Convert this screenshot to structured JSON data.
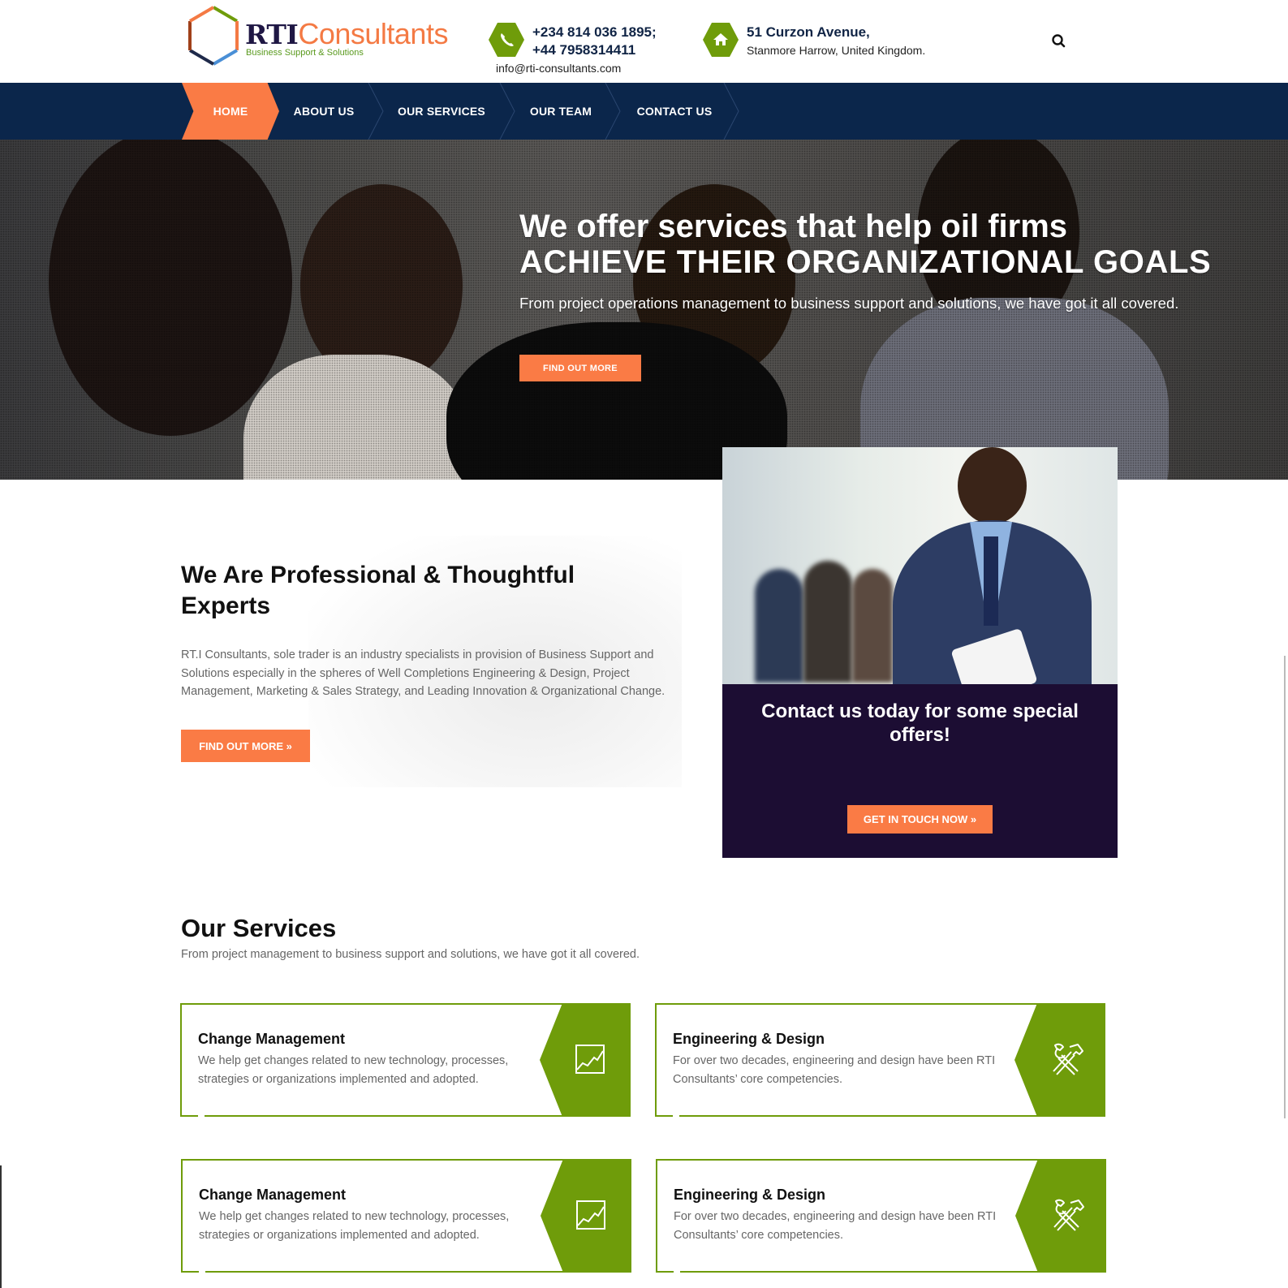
{
  "header": {
    "logo": {
      "brand_bold": "RTI",
      "brand_light": "Consultants",
      "tagline": "Business Support & Solutions",
      "colors": {
        "dark": "#1f1744",
        "orange": "#f47a44",
        "green": "#5a9a1e"
      }
    },
    "phone": {
      "icon": "phone-icon",
      "line1": "+234 814 036 1895;",
      "line2": "+44 7958314411"
    },
    "email": "info@rti-consultants.com",
    "address": {
      "icon": "home-icon",
      "line1": "51 Curzon Avenue,",
      "line2": "Stanmore Harrow, United Kingdom."
    },
    "search_icon": "search-icon"
  },
  "nav": {
    "items": [
      {
        "label": "HOME",
        "active": true
      },
      {
        "label": "ABOUT US",
        "active": false
      },
      {
        "label": "OUR SERVICES",
        "active": false
      },
      {
        "label": "OUR TEAM",
        "active": false
      },
      {
        "label": "CONTACT US",
        "active": false
      }
    ]
  },
  "hero": {
    "title_line1": "We offer services that help oil firms",
    "title_line2": "ACHIEVE THEIR ORGANIZATIONAL GOALS",
    "subtitle": "From project operations management to business support and solutions, we have got it all covered.",
    "button": "FIND OUT MORE"
  },
  "about": {
    "heading": "We Are Professional & Thoughtful Experts",
    "body": "RT.I Consultants, sole trader is an industry specialists in provision of Business Support and Solutions especially in the spheres of Well Completions Engineering & Design, Project Management, Marketing & Sales Strategy, and Leading Innovation & Organizational Change.",
    "button": "FIND OUT MORE  »"
  },
  "cta": {
    "title": "Contact us today for some special offers!",
    "button": "GET IN TOUCH NOW  »"
  },
  "services": {
    "heading": "Our Services",
    "subtitle": "From project management to business support and solutions, we have got it all covered.",
    "cards": [
      {
        "title": "Change Management",
        "desc": "We help get changes related to new technology, processes, strategies or organizations implemented and adopted.",
        "icon": "chart-icon"
      },
      {
        "title": "Engineering & Design",
        "desc": "For over two decades, engineering and design have been RTI Consultants’ core competencies.",
        "icon": "tools-icon"
      },
      {
        "title": "Change Management",
        "desc": "We help get changes related to new technology, processes, strategies or organizations implemented and adopted.",
        "icon": "chart-icon"
      },
      {
        "title": "Engineering & Design",
        "desc": "For over two decades, engineering and design have been RTI Consultants’ core competencies.",
        "icon": "tools-icon"
      }
    ]
  },
  "colors": {
    "nav_bg": "#0b264b",
    "accent_orange": "#fa7b45",
    "accent_green": "#6f9c0a",
    "cta_bg": "#1c0d33"
  }
}
